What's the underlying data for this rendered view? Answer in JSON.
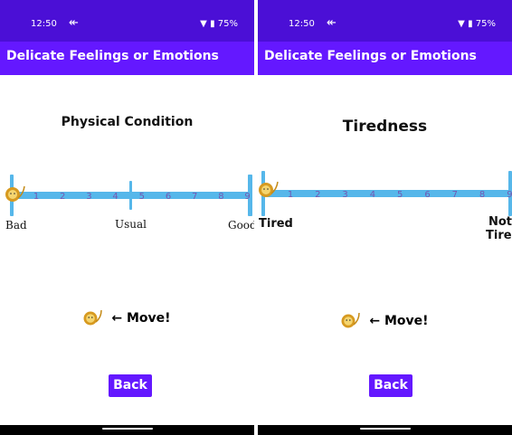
{
  "colors": {
    "status_bar": "#4b0fd6",
    "app_bar": "#6418ff",
    "track": "#56b7ea",
    "tick_text": "#7357b3",
    "button": "#6418ff"
  },
  "panels": [
    {
      "status": {
        "time": "12:50",
        "battery": "75%"
      },
      "app_title": "Delicate Feelings or Emotions",
      "condition_title": "Physical Condition",
      "scale": {
        "numbers": [
          "1",
          "2",
          "3",
          "4",
          "5",
          "6",
          "7",
          "8",
          "9"
        ],
        "labels": {
          "left": "Bad",
          "center": "Usual",
          "right": "Good"
        },
        "marker_position": 0
      },
      "move_text": "← Move!",
      "back_label": "Back"
    },
    {
      "status": {
        "time": "12:50",
        "battery": "75%"
      },
      "app_title": "Delicate Feelings or Emotions",
      "condition_title": "Tiredness",
      "scale": {
        "numbers": [
          "1",
          "2",
          "3",
          "4",
          "5",
          "6",
          "7",
          "8",
          "9"
        ],
        "labels": {
          "left": "Tired",
          "right_line1": "Not",
          "right_line2": "Tired"
        },
        "marker_position": 0
      },
      "move_text": "← Move!",
      "back_label": "Back"
    }
  ]
}
